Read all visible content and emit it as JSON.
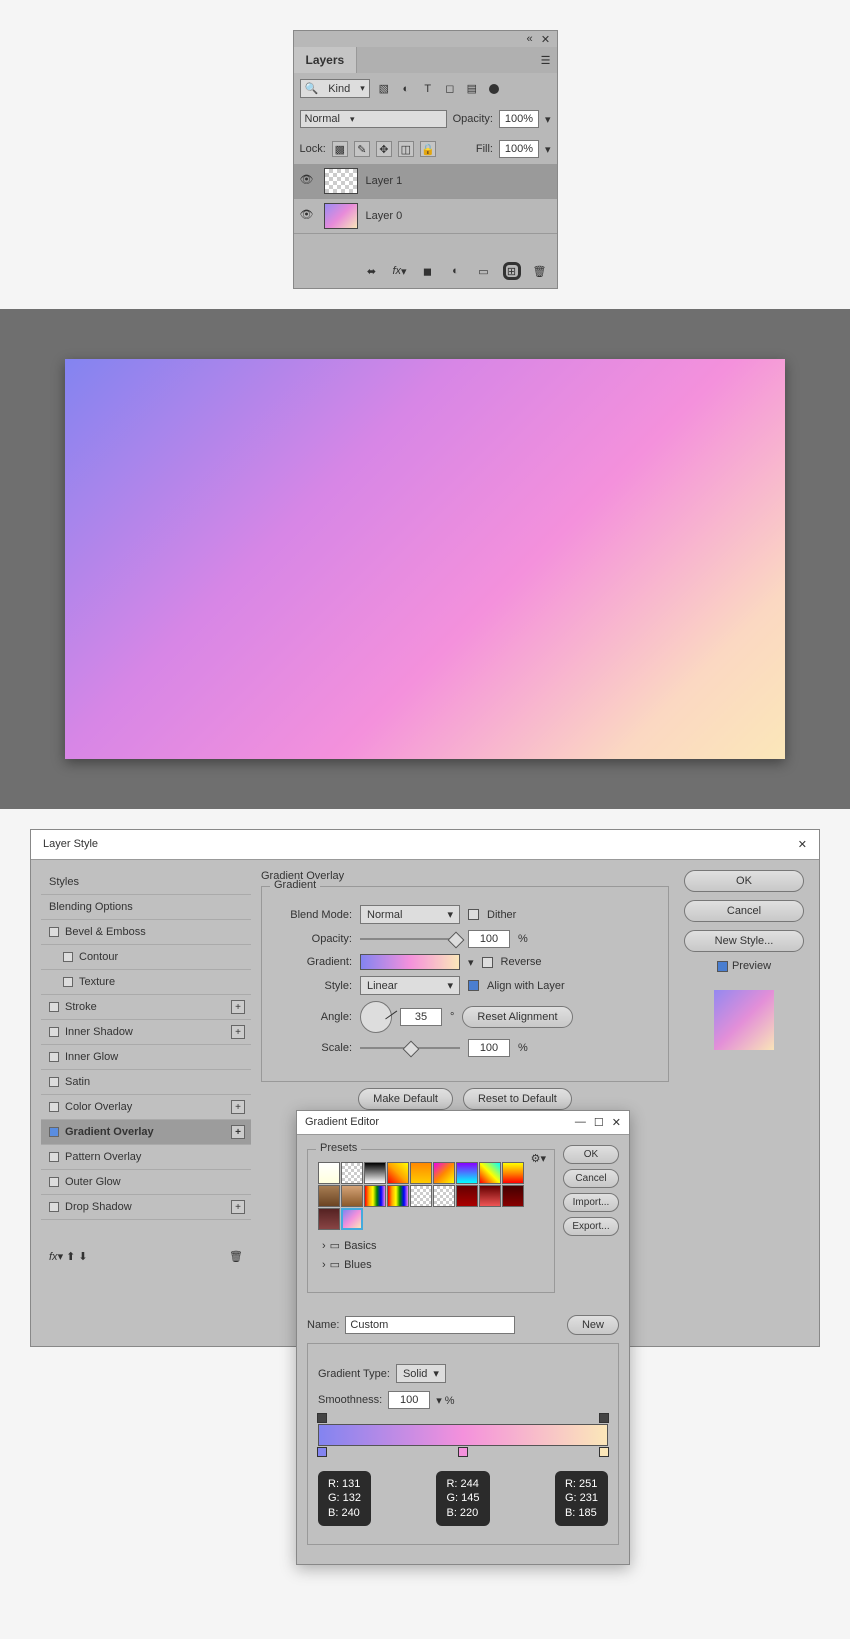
{
  "layers_panel": {
    "tab": "Layers",
    "filter": "Kind",
    "blend_mode": "Normal",
    "opacity_label": "Opacity:",
    "opacity_value": "100%",
    "lock_label": "Lock:",
    "fill_label": "Fill:",
    "fill_value": "100%",
    "layer1": "Layer 1",
    "layer0": "Layer 0"
  },
  "layer_style": {
    "title": "Layer Style",
    "styles_header": "Styles",
    "blending_header": "Blending Options",
    "items": {
      "bevel": "Bevel & Emboss",
      "contour": "Contour",
      "texture": "Texture",
      "stroke": "Stroke",
      "inner_shadow": "Inner Shadow",
      "inner_glow": "Inner Glow",
      "satin": "Satin",
      "color_overlay": "Color Overlay",
      "gradient_overlay": "Gradient Overlay",
      "pattern_overlay": "Pattern Overlay",
      "outer_glow": "Outer Glow",
      "drop_shadow": "Drop Shadow"
    },
    "section_title": "Gradient Overlay",
    "gradient_sub": "Gradient",
    "blend_mode_label": "Blend Mode:",
    "blend_mode_val": "Normal",
    "dither": "Dither",
    "opacity_label": "Opacity:",
    "opacity_val": "100",
    "gradient_label": "Gradient:",
    "reverse": "Reverse",
    "style_label": "Style:",
    "style_val": "Linear",
    "align": "Align with Layer",
    "angle_label": "Angle:",
    "angle_val": "35",
    "reset_align": "Reset Alignment",
    "scale_label": "Scale:",
    "scale_val": "100",
    "make_default": "Make Default",
    "reset_default": "Reset to Default",
    "ok": "OK",
    "cancel": "Cancel",
    "new_style": "New Style...",
    "preview": "Preview"
  },
  "gradient_editor": {
    "title": "Gradient Editor",
    "presets": "Presets",
    "basics": "Basics",
    "blues": "Blues",
    "name_label": "Name:",
    "name_val": "Custom",
    "new_btn": "New",
    "type_label": "Gradient Type:",
    "type_val": "Solid",
    "smooth_label": "Smoothness:",
    "smooth_val": "100",
    "ok": "OK",
    "cancel": "Cancel",
    "import": "Import...",
    "export": "Export...",
    "rgb1": {
      "r": "R: 131",
      "g": "G: 132",
      "b": "B: 240"
    },
    "rgb2": {
      "r": "R: 244",
      "g": "G: 145",
      "b": "B: 220"
    },
    "rgb3": {
      "r": "R: 251",
      "g": "G: 231",
      "b": "B: 185"
    }
  }
}
